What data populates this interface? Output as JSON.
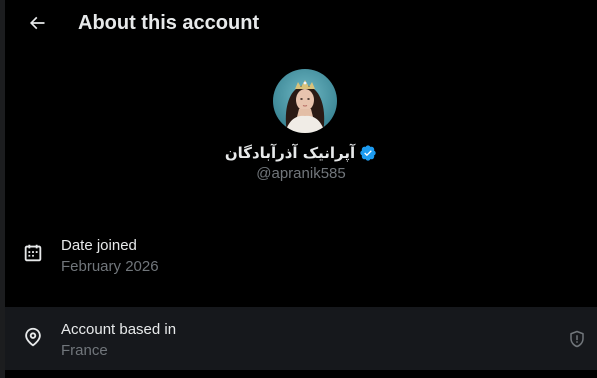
{
  "header": {
    "title": "About this account",
    "back_icon": "arrow-left-icon"
  },
  "profile": {
    "display_name": "آپرانیک آذرآبادگان",
    "verified_icon": "verified-badge-icon",
    "handle": "@apranik585",
    "avatar_icon": "profile-avatar"
  },
  "details": {
    "joined": {
      "icon": "calendar-icon",
      "label": "Date joined",
      "value": "February 2026"
    },
    "based_in": {
      "icon": "location-pin-icon",
      "label": "Account based in",
      "value": "France",
      "info_icon": "shield-info-icon"
    }
  },
  "colors": {
    "background": "#000000",
    "primary_text": "#e7e9ea",
    "secondary_text": "#71767b",
    "verified_blue": "#1d9bf0",
    "row_highlight": "#16181c"
  }
}
